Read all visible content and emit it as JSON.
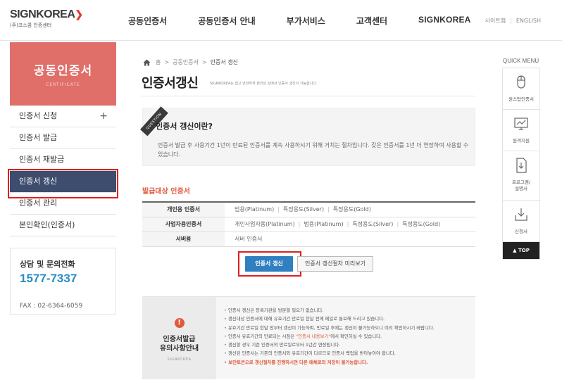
{
  "header": {
    "logo_main": "SIGNKOREA",
    "logo_sub": "(주)코스콤 인증센터",
    "nav": [
      "공동인증서",
      "공동인증서 안내",
      "부가서비스",
      "고객센터",
      "SIGNKOREA"
    ],
    "util": [
      "사이트맵",
      "ENGLISH"
    ]
  },
  "sidebar": {
    "title": "공동인증서",
    "subtitle": "CERTIFICATE",
    "items": [
      {
        "label": "인증서 신청",
        "has_plus": true
      },
      {
        "label": "인증서 발급"
      },
      {
        "label": "인증서 재발급"
      },
      {
        "label": "인증서 갱신",
        "active": true
      },
      {
        "label": "인증서 관리"
      },
      {
        "label": "본인확인(인증서)"
      }
    ],
    "contact_title": "상담 및 문의전화",
    "contact_phone": "1577-7337",
    "fax": "FAX : 02-6364-6059"
  },
  "breadcrumb": [
    "홈",
    "공동인증서",
    "인증서 갱신"
  ],
  "page": {
    "title": "인증서갱신",
    "desc": "SIGNKOREA는 쉽고 안전하게 편리성 상에서 인증서 갱신이 가능합니다."
  },
  "question": {
    "ribbon": "QUESTION",
    "title": "인증서 갱신이란?",
    "text": "인증서 발급 후 사용기간 1년이 만료된 인증서를 계속 사용하시기 위해 거치는 절차입니다. 갖은 인증서를 1년 더 연장하여 사용할 수 있습니다."
  },
  "target": {
    "title": "발급대상 인증서",
    "rows": [
      {
        "head": "개인용 인증서",
        "values": [
          "범용(Platinum)",
          "특정용도(Silver)",
          "특정용도(Gold)"
        ]
      },
      {
        "head": "사업자용인증서",
        "values": [
          "개인사업자용(Platinum)",
          "범용(Platinum)",
          "특정용도(Silver)",
          "특정용도(Gold)"
        ]
      },
      {
        "head": "서버용",
        "values": [
          "서버 인증서"
        ]
      }
    ]
  },
  "buttons": {
    "renew": "인증서 갱신",
    "preview": "인증서 갱신절차 미리보기"
  },
  "notice": {
    "icon": "!",
    "title_line1": "인증서발급",
    "title_line2": "유의사항안내",
    "sub": "SIGNKOREA",
    "items": [
      {
        "text": "인증서 갱신은 등록기관을 방문할 필요가 없습니다."
      },
      {
        "text": "갱신대상 인증서에 대해 유효기간 만료일 한달 전에 메일로 통보해 드리고 있습니다."
      },
      {
        "text": "유효기간 만료일 한달 전부터 갱신이 가능하며, 만료일 후에는 갱신이 불가능하오니 미리 확인하시기 바랍니다."
      },
      {
        "pre": "인증서 유효기간의 만료되는 시점은 ",
        "hl": "\"인증서 내용보기\"",
        "post": "에서 확인하실 수 있습니다."
      },
      {
        "text": "갱신할 경우 기존 인증서의 만료일로부터 1년간 연장됩니다."
      },
      {
        "text": "갱신된 인증서는 기존의 인증서와 유효기간이 다르므로 인증서 백업을 받아놓아야 합니다."
      },
      {
        "text": "보안토큰으로 갱신절차를 진행하시면 다른 매체로의 저장이 불가능합니다.",
        "red": true
      }
    ]
  },
  "quick": {
    "title": "QUICK MENU",
    "items": [
      {
        "label": "원스탑인증서",
        "icon": "mouse-icon"
      },
      {
        "label": "원격지원",
        "icon": "monitor-chart-icon"
      },
      {
        "label": "프로그램/\n설명서",
        "icon": "document-download-icon"
      },
      {
        "label": "신청서",
        "icon": "tray-download-icon"
      }
    ],
    "top": "▲ TOP"
  }
}
